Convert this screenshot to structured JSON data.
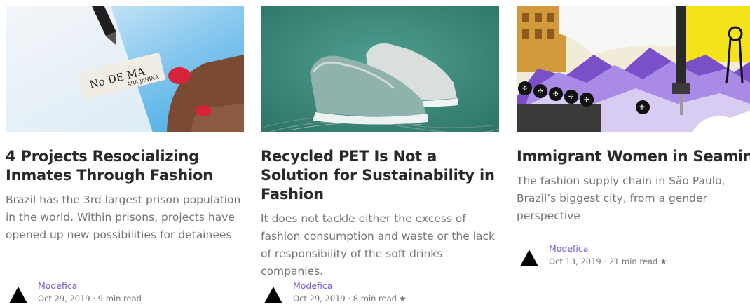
{
  "cards": [
    {
      "title": "4 Projects Resocializing Inmates Through Fashion",
      "subtitle": "Brazil has the 3rd largest prison population in the world. Within prisons, projects have opened up new possibilities for detainees",
      "author": "Modefica",
      "date": "Oct 29, 2019",
      "separator": "·",
      "read_time": "9 min read",
      "starred": false
    },
    {
      "title": "Recycled PET Is Not a Solution for Sustainability in Fashion",
      "subtitle": "It does not tackle either the excess of fashion consumption and waste or the lack of responsibility of the soft drinks companies.",
      "author": "Modefica",
      "date": "Oct 29, 2019",
      "separator": "·",
      "read_time": "8 min read",
      "starred": true
    },
    {
      "title": "Immigrant Women in Seaming",
      "subtitle": "The fashion supply chain in São Paulo, Brazil’s biggest city, from a gender perspective",
      "author": "Modefica",
      "date": "Oct 13, 2019",
      "separator": "·",
      "read_time": "21 min read",
      "starred": true
    }
  ],
  "icons": {
    "star": "★",
    "avatar": "triangle-logo-icon"
  },
  "colors": {
    "title": "#292929",
    "body": "#757575",
    "author": "#6b5fd1"
  }
}
